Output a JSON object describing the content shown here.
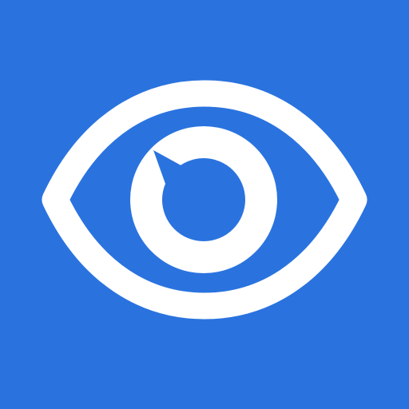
{
  "icon": {
    "name": "eye-icon",
    "pupil": "eye-pupil-icon"
  },
  "colors": {
    "background": "#2A73DF",
    "foreground": "#FFFFFF"
  }
}
